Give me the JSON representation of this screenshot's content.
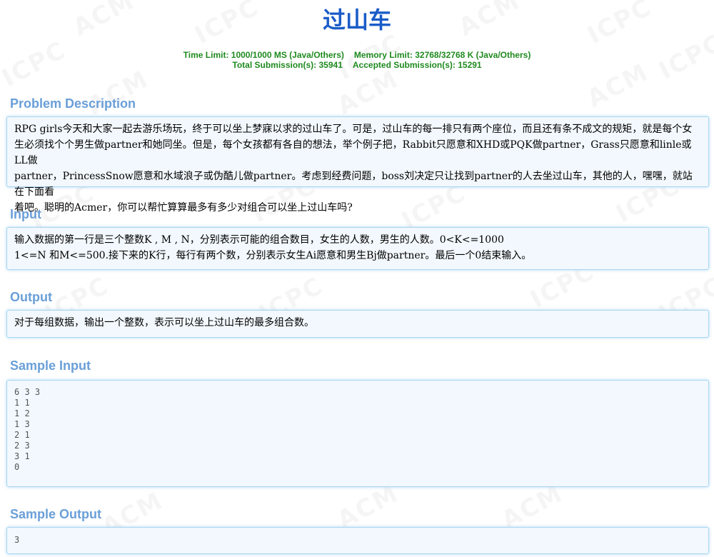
{
  "problem": {
    "title": "过山车",
    "limits": {
      "time_limit": "Time Limit: 1000/1000 MS (Java/Others)",
      "memory_limit": "Memory Limit: 32768/32768 K (Java/Others)",
      "total_submissions": "Total Submission(s): 35941",
      "accepted_submissions": "Accepted Submission(s): 15291"
    }
  },
  "watermark": {
    "acm": "ACM",
    "icpc": "ICPC"
  },
  "sections": {
    "description": {
      "heading": "Problem Description",
      "lines": [
        "RPG girls今天和大家一起去游乐场玩，终于可以坐上梦寐以求的过山车了。可是，过山车的每一排只有两个座位，而且还有条不成文的规矩，就是每个女",
        "生必须找个个男生做partner和她同坐。但是，每个女孩都有各自的想法，举个例子把，Rabbit只愿意和XHD或PQK做partner，Grass只愿意和linle或LL做",
        "partner，PrincessSnow愿意和水域浪子或伪酷儿做partner。考虑到经费问题，boss刘决定只让找到partner的人去坐过山车，其他的人，嘿嘿，就站在下面看",
        "着吧。聪明的Acmer，你可以帮忙算算最多有多少对组合可以坐上过山车吗?"
      ]
    },
    "input": {
      "heading": "Input",
      "lines": [
        "输入数据的第一行是三个整数K , M , N，分别表示可能的组合数目，女生的人数，男生的人数。0<K<=1000",
        "1<=N 和M<=500.接下来的K行，每行有两个数，分别表示女生Ai愿意和男生Bj做partner。最后一个0结束输入。"
      ]
    },
    "output": {
      "heading": "Output",
      "lines": [
        "对于每组数据，输出一个整数，表示可以坐上过山车的最多组合数。"
      ]
    },
    "sample_input": {
      "heading": "Sample Input",
      "text": "6 3 3\n1 1\n1 2\n1 3\n2 1\n2 3\n3 1\n0"
    },
    "sample_output": {
      "heading": "Sample Output",
      "text": "3"
    }
  }
}
